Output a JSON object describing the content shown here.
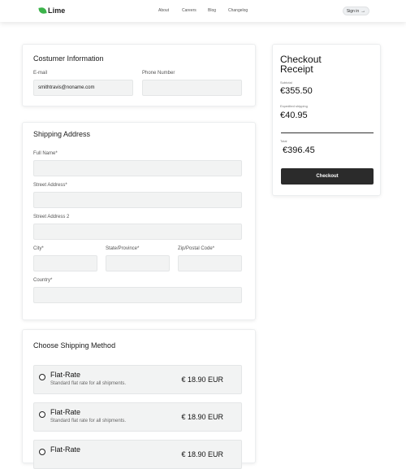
{
  "header": {
    "logo_text": "Lime",
    "nav": [
      "About",
      "Careers",
      "Blog",
      "Changelog"
    ],
    "signin_label": "Sign in",
    "signin_arrow": "→"
  },
  "customer": {
    "title": "Costumer Information",
    "email_label": "E-mail",
    "email_value": "smithtravis@noname.com",
    "phone_label": "Phone Number",
    "phone_value": ""
  },
  "shipping": {
    "title": "Shipping Address",
    "full_name_label": "Full Name*",
    "street_label": "Street Address*",
    "street2_label": "Street Address 2",
    "city_label": "City*",
    "state_label": "State/Province*",
    "zip_label": "Zip/Postal Code*",
    "country_label": "Country*"
  },
  "receipt": {
    "title": "Checkout Receipt",
    "subtotal_label": "Subtotal",
    "subtotal_value": "€355.50",
    "shipping_label": "Expedited shipping",
    "shipping_value": "€40.95",
    "total_label": "Total",
    "total_value": "€396.45",
    "checkout_label": "Checkout"
  },
  "method": {
    "title": "Choose Shipping Method",
    "options": [
      {
        "title": "Flat-Rate",
        "desc": "Standard flat rate for all shipments.",
        "price": "€ 18.90 EUR"
      },
      {
        "title": "Flat-Rate",
        "desc": "Standard flat rate for all shipments.",
        "price": "€ 18.90 EUR"
      },
      {
        "title": "Flat-Rate",
        "desc": "",
        "price": "€ 18.90 EUR"
      }
    ]
  }
}
